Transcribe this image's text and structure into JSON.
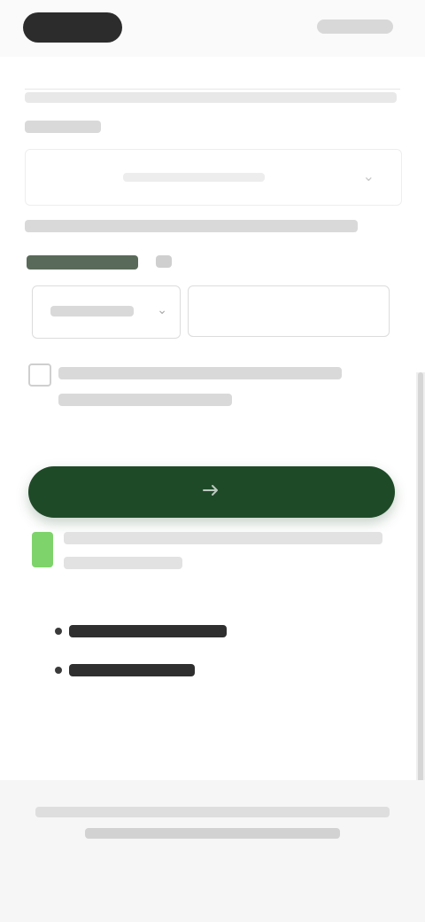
{
  "status_bar": {
    "left_pill": "",
    "right_indicators": ""
  },
  "phone": {
    "section_title": "",
    "country_code": "",
    "number_value": "",
    "number_placeholder": ""
  },
  "primary_button": {
    "label": ""
  },
  "colors": {
    "primary": "#1f4a28",
    "accent": "#7ed46b",
    "footer_bg": "#f6f6f6"
  }
}
